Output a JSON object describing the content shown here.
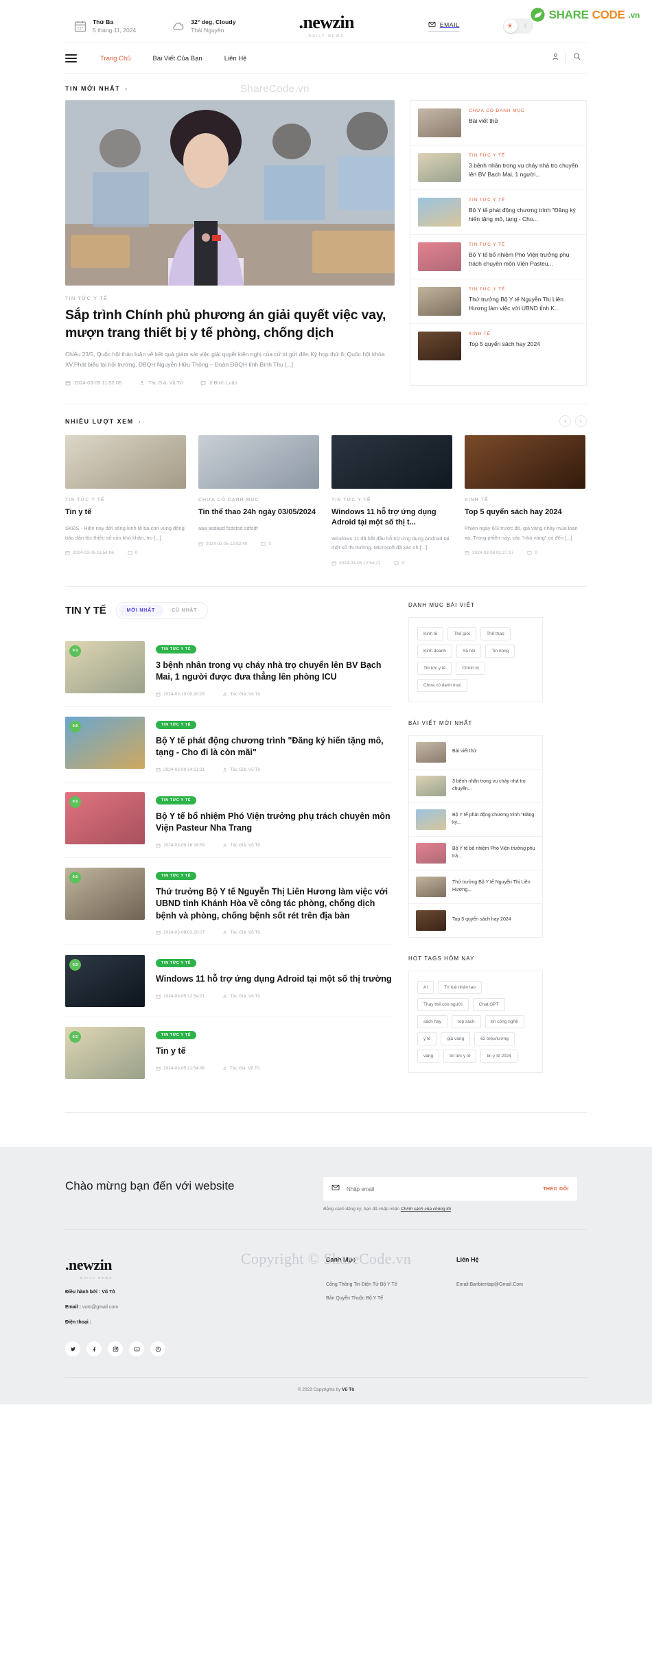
{
  "topbar": {
    "date_label": "Thứ Ba",
    "date_value": "5 tháng 11, 2024",
    "weather_label": "32° deg, Cloudy",
    "weather_city": "Thái Nguyên",
    "email_label": "EMAIL",
    "logo": ".newzin",
    "logo_sub": "DAILY NEWS",
    "badge": {
      "share": "SHARE",
      "code": "CODE",
      "vn": ".vn"
    }
  },
  "nav": {
    "items": [
      {
        "label": "Trang Chủ",
        "active": true
      },
      {
        "label": "Bài Viết Của Bạn",
        "active": false
      },
      {
        "label": "Liên Hệ",
        "active": false
      }
    ]
  },
  "watermark": {
    "inline": "ShareCode.vn",
    "footer": "Copyright © ShareCode.vn"
  },
  "sections": {
    "latest": {
      "title": "TIN MỚI NHẤT"
    },
    "popular": {
      "title": "NHIỀU LƯỢT XEM"
    }
  },
  "hero": {
    "kicker": "TIN TỨC Y TẾ",
    "title": "Sắp trình Chính phủ phương án giải quyết việc vay, mượn trang thiết bị y tế phòng, chống dịch",
    "excerpt": "Chiều 23/5, Quốc hội thảo luận về kết quả giám sát việc giải quyết kiến nghị của cử tri gửi đến Kỳ họp thứ 6, Quốc hội khóa XV.Phát biểu tại hội trường, ĐBQH Nguyễn Hữu Thông – Đoàn ĐBQH tỉnh Bình Thu [...]",
    "date": "2024-03-05 11:52:06",
    "author": "Tác Giả: Vũ Tô",
    "comments": "0 Bình Luận"
  },
  "hero_side": [
    {
      "kicker": "CHƯA CÓ DANH MỤC",
      "title": "Bài viết thử"
    },
    {
      "kicker": "TIN TỨC Y TẾ",
      "title": "3 bệnh nhân trong vụ cháy nhà trọ chuyển lên BV Bạch Mai, 1 người..."
    },
    {
      "kicker": "TIN TỨC Y TẾ",
      "title": "Bộ Y tế phát động chương trình \"Đăng ký hiến tặng mô, tạng - Cho..."
    },
    {
      "kicker": "TIN TỨC Y TẾ",
      "title": "Bộ Y tế bổ nhiệm Phó Viện trưởng phụ trách chuyên môn Viện Pasteu..."
    },
    {
      "kicker": "TIN TỨC Y TẾ",
      "title": "Thứ trưởng Bộ Y tế Nguyễn Thị Liên Hương làm việc với UBND tỉnh K..."
    },
    {
      "kicker": "KINH TẾ",
      "title": "Top 5 quyển sách hay 2024"
    }
  ],
  "popular_cards": [
    {
      "kicker": "TIN TỨC Y TẾ",
      "title": "Tin y tế",
      "excerpt": "SKĐS - Hiện nay đời sống kinh tế bà con vùng đồng bào dân tộc thiểu số còn khó khăn, tro [...]",
      "date": "2024-03-05 11:54:06",
      "comments": "0"
    },
    {
      "kicker": "CHƯA CÓ DANH MỤC",
      "title": "Tin thể thao 24h ngày 03/05/2024",
      "excerpt": "aaa asdasd fsdsfsd sdfsdf",
      "date": "2024-03-05 12:52:40",
      "comments": "0"
    },
    {
      "kicker": "TIN TỨC Y TẾ",
      "title": "Windows 11 hỗ trợ ứng dụng Adroid tại một số thị t...",
      "excerpt": "Windows 11 đã bắt đầu hỗ trợ ứng dụng Android tại một số thị trường. Microsoft đã xác nh [...]",
      "date": "2024-03-05 12:54:21",
      "comments": "0"
    },
    {
      "kicker": "KINH TẾ",
      "title": "Top 5 quyển sách hay 2024",
      "excerpt": "Phiên ngày 6/3 trước đó, giá vàng nhảy múa loạn xạ. Trong phiên này, các \"nhà vàng\" có đến [...]",
      "date": "2024-03-08 01:27:17",
      "comments": "0"
    }
  ],
  "health": {
    "title": "TIN Y TẾ",
    "tabs": [
      {
        "label": "MỚI NHẤT",
        "active": true
      },
      {
        "label": "CŨ NHẤT",
        "active": false
      }
    ],
    "articles": [
      {
        "score": "9.5",
        "badge": "TIN TỨC Y TẾ",
        "title": "3 bệnh nhân trong vụ cháy nhà trọ chuyển lên BV Bạch Mai, 1 người được đưa thẳng lên phòng ICU",
        "date": "2024-03-10 00:20:29",
        "author": "Tác Giả: Vũ Tô"
      },
      {
        "score": "9.5",
        "badge": "TIN TỨC Y TẾ",
        "title": "Bộ Y tế phát động chương trình \"Đăng ký hiến tặng mô, tạng - Cho đi là còn mãi\"",
        "date": "2024-03-09 14:21:31",
        "author": "Tác Giả: Vũ Tô"
      },
      {
        "score": "9.5",
        "badge": "TIN TỨC Y TẾ",
        "title": "Bộ Y tế bổ nhiệm Phó Viện trưởng phụ trách chuyên môn Viện Pasteur Nha Trang",
        "date": "2024-03-09 16:16:59",
        "author": "Tác Giả: Vũ Tô"
      },
      {
        "score": "9.5",
        "badge": "TIN TỨC Y TẾ",
        "title": "Thứ trưởng Bộ Y tế Nguyễn Thị Liên Hương làm việc với UBND tỉnh Khánh Hòa về công tác phòng, chống dịch bệnh và phòng, chống bệnh sốt rét trên địa bàn",
        "date": "2024-03-08 02:20:07",
        "author": "Tác Giả: Vũ Tô"
      },
      {
        "score": "9.5",
        "badge": "TIN TỨC Y TẾ",
        "title": "Windows 11 hỗ trợ ứng dụng Adroid tại một số thị trường",
        "date": "2024-03-05 12:54:21",
        "author": "Tác Giả: Vũ Tô"
      },
      {
        "score": "9.5",
        "badge": "TIN TỨC Y TẾ",
        "title": "Tin y tế",
        "date": "2024-03-05 11:54:06",
        "author": "Tác Giả: Vũ Tô"
      }
    ]
  },
  "sidebar": {
    "categories_title": "DANH MỤC BÀI VIẾT",
    "categories": [
      "Kinh tế",
      "Thế giới",
      "Thể thao",
      "Kinh doanh",
      "Xã hội",
      "Tin nóng",
      "Tin tức y tế",
      "Chính trị",
      "Chưa có danh mục"
    ],
    "latest_title": "BÀI VIẾT MỚI NHẤT",
    "latest": [
      {
        "title": "Bài viết thử"
      },
      {
        "title": "3 bệnh nhân trong vụ cháy nhà trọ chuyển..."
      },
      {
        "title": "Bộ Y tế phát động chương trình \"Đăng ký..."
      },
      {
        "title": "Bộ Y tế bổ nhiệm Phó Viện trưởng phụ trà..."
      },
      {
        "title": "Thứ trưởng Bộ Y tế Nguyễn Thị Liên Hương..."
      },
      {
        "title": "Top 5 quyển sách hay 2024"
      }
    ],
    "tags_title": "HOT TAGS HÔM NAY",
    "tags": [
      "AI",
      "Trí tuệ nhân tạo",
      "Thay thế con người",
      "Chat GPT",
      "sách hay",
      "top sách",
      "tin công nghệ",
      "y tế",
      "giá vàng",
      "62 triệu/lượng",
      "vàng",
      "tin tức y tế",
      "tin y tế 2024"
    ]
  },
  "footer": {
    "welcome": "Chào mừng bạn đến với website",
    "email_placeholder": "Nhập email",
    "subscribe_label": "THEO DÕI",
    "policy_prefix": "Bằng cách đăng ký, bạn đã chấp nhận ",
    "policy_link": "Chính sách của chúng tôi",
    "logo": ".newzin",
    "logo_sub": "DAILY NEWS",
    "operator_label": "Điều hành bởi : ",
    "operator_value": "Vũ Tô",
    "email_label": "Email : ",
    "email_value": "vuto@gmail.com",
    "phone_label": "Điện thoại :",
    "col_danhmuc_title": "Danh Mục",
    "col_danhmuc_items": [
      "Cổng Thông Tin Điện Tử Bộ Y Tế",
      "Bản Quyền Thuộc Bộ Y Tế"
    ],
    "col_lienhe_title": "Liên Hệ",
    "col_lienhe_items": [
      "Email:Banbientap@Gmail.Com"
    ],
    "copyright_prefix": "© 2023 Copyrights by ",
    "copyright_name": "Vũ Tô"
  }
}
